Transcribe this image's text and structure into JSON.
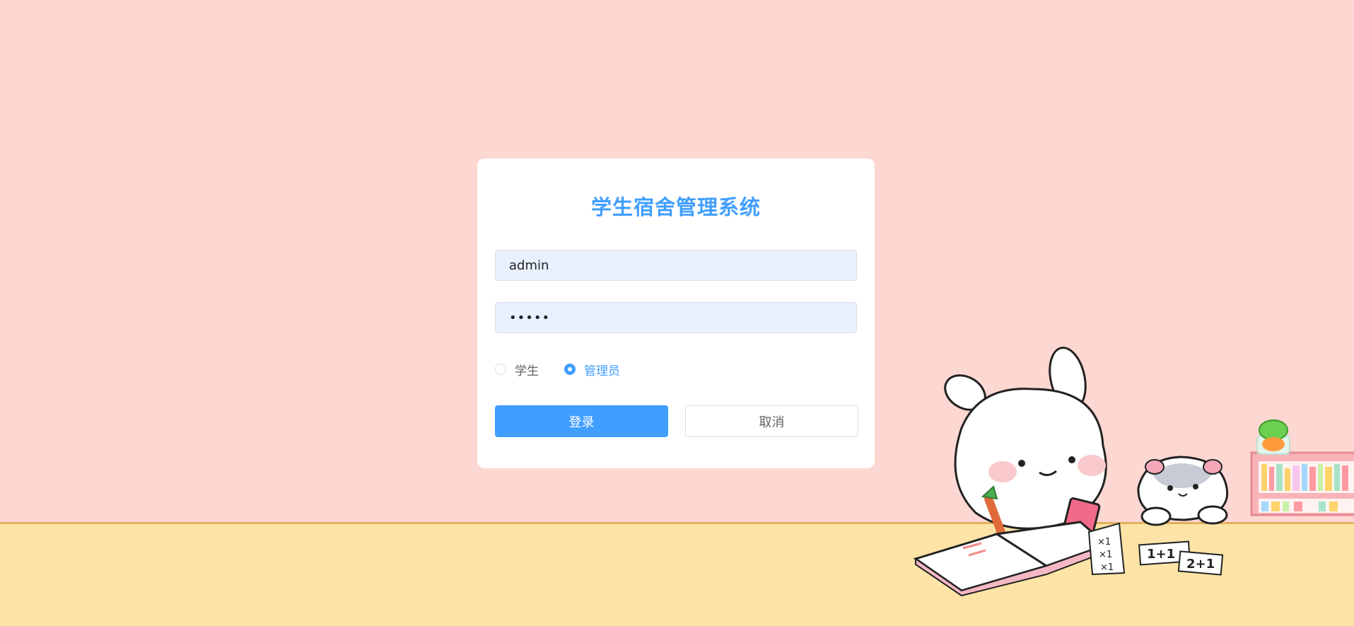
{
  "page": {
    "background_color": "#fdd7d1",
    "floor_color": "#fde4a6"
  },
  "login": {
    "title": "学生宿舍管理系统",
    "username_value": "admin",
    "password_value": "•••••",
    "roles": [
      {
        "label": "学生",
        "checked": false
      },
      {
        "label": "管理员",
        "checked": true
      }
    ],
    "login_label": "登录",
    "cancel_label": "取消",
    "accent_color": "#409eff"
  },
  "illustration": {
    "characters": [
      "bunny-icon",
      "hamster-icon"
    ],
    "objects": [
      "open-book-icon",
      "bookshelf-icon",
      "carrot-icon",
      "notebook-icon",
      "worksheet-icon"
    ],
    "worksheet_texts": [
      "1+1",
      "2+1"
    ]
  }
}
